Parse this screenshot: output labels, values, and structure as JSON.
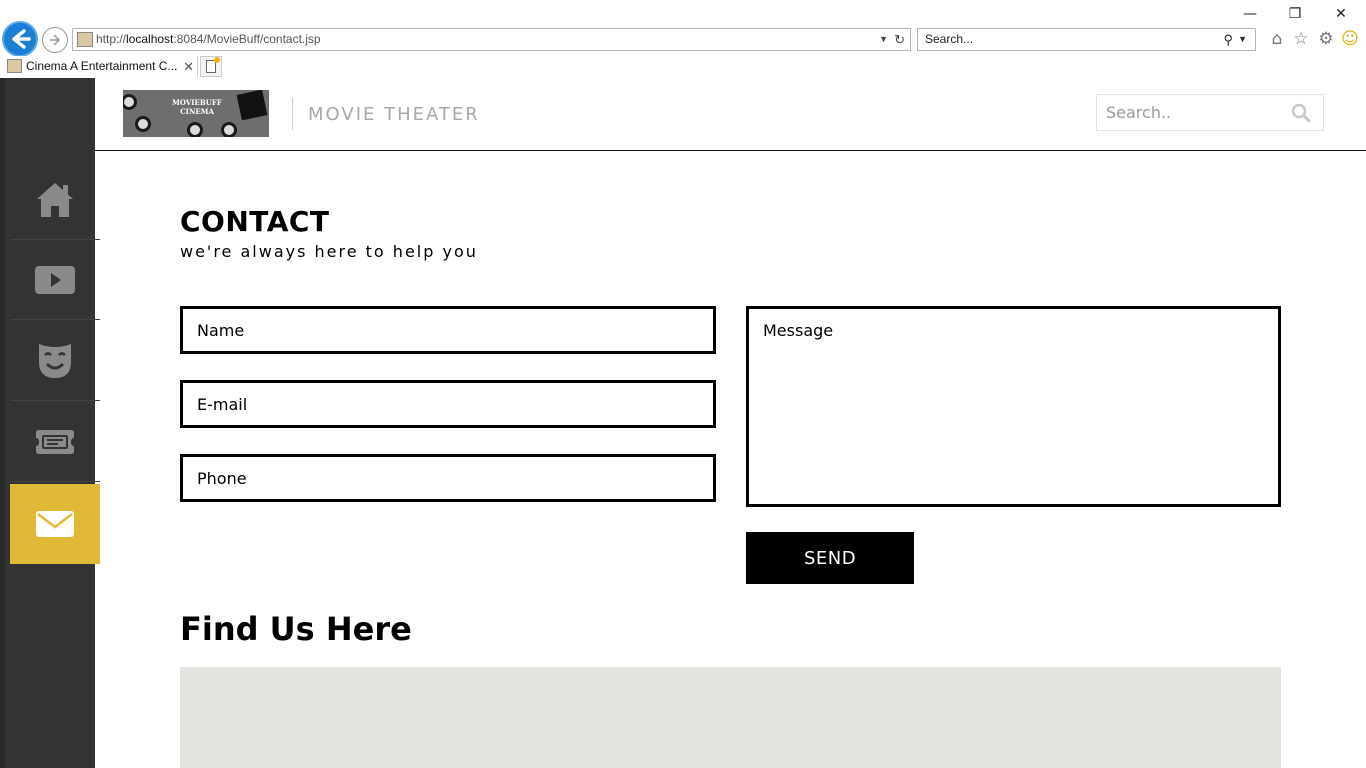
{
  "browser": {
    "url_prefix": "http://",
    "url_host": "localhost",
    "url_rest": ":8084/MovieBuff/contact.jsp",
    "search_placeholder": "Search...",
    "tab_title": "Cinema A Entertainment C...",
    "window_controls": {
      "minimize": "—",
      "restore": "❐",
      "close": "✕"
    },
    "toolbar_icons": [
      "home-icon",
      "favorites-star-icon",
      "settings-gear-icon",
      "smiley-feedback-icon"
    ]
  },
  "sidebar": {
    "items": [
      {
        "name": "home",
        "icon": "home-icon",
        "active": false
      },
      {
        "name": "movies",
        "icon": "play-icon",
        "active": false
      },
      {
        "name": "theater",
        "icon": "mask-icon",
        "active": false
      },
      {
        "name": "tickets",
        "icon": "ticket-icon",
        "active": false
      },
      {
        "name": "contact",
        "icon": "mail-icon",
        "active": true
      }
    ],
    "colors": {
      "background": "#333333",
      "active": "#e0b936",
      "icon": "#8a8a8a"
    }
  },
  "header": {
    "logo_text": "MOVIEBUFF CINEMA",
    "site_title": "MOVIE THEATER",
    "search_placeholder": "Search.."
  },
  "contact": {
    "title": "CONTACT",
    "subtitle": "we're always here to help you",
    "name_placeholder": "Name",
    "email_placeholder": "E-mail",
    "phone_placeholder": "Phone",
    "message_placeholder": "Message",
    "send_label": "SEND"
  },
  "map_section": {
    "title": "Find Us Here"
  }
}
